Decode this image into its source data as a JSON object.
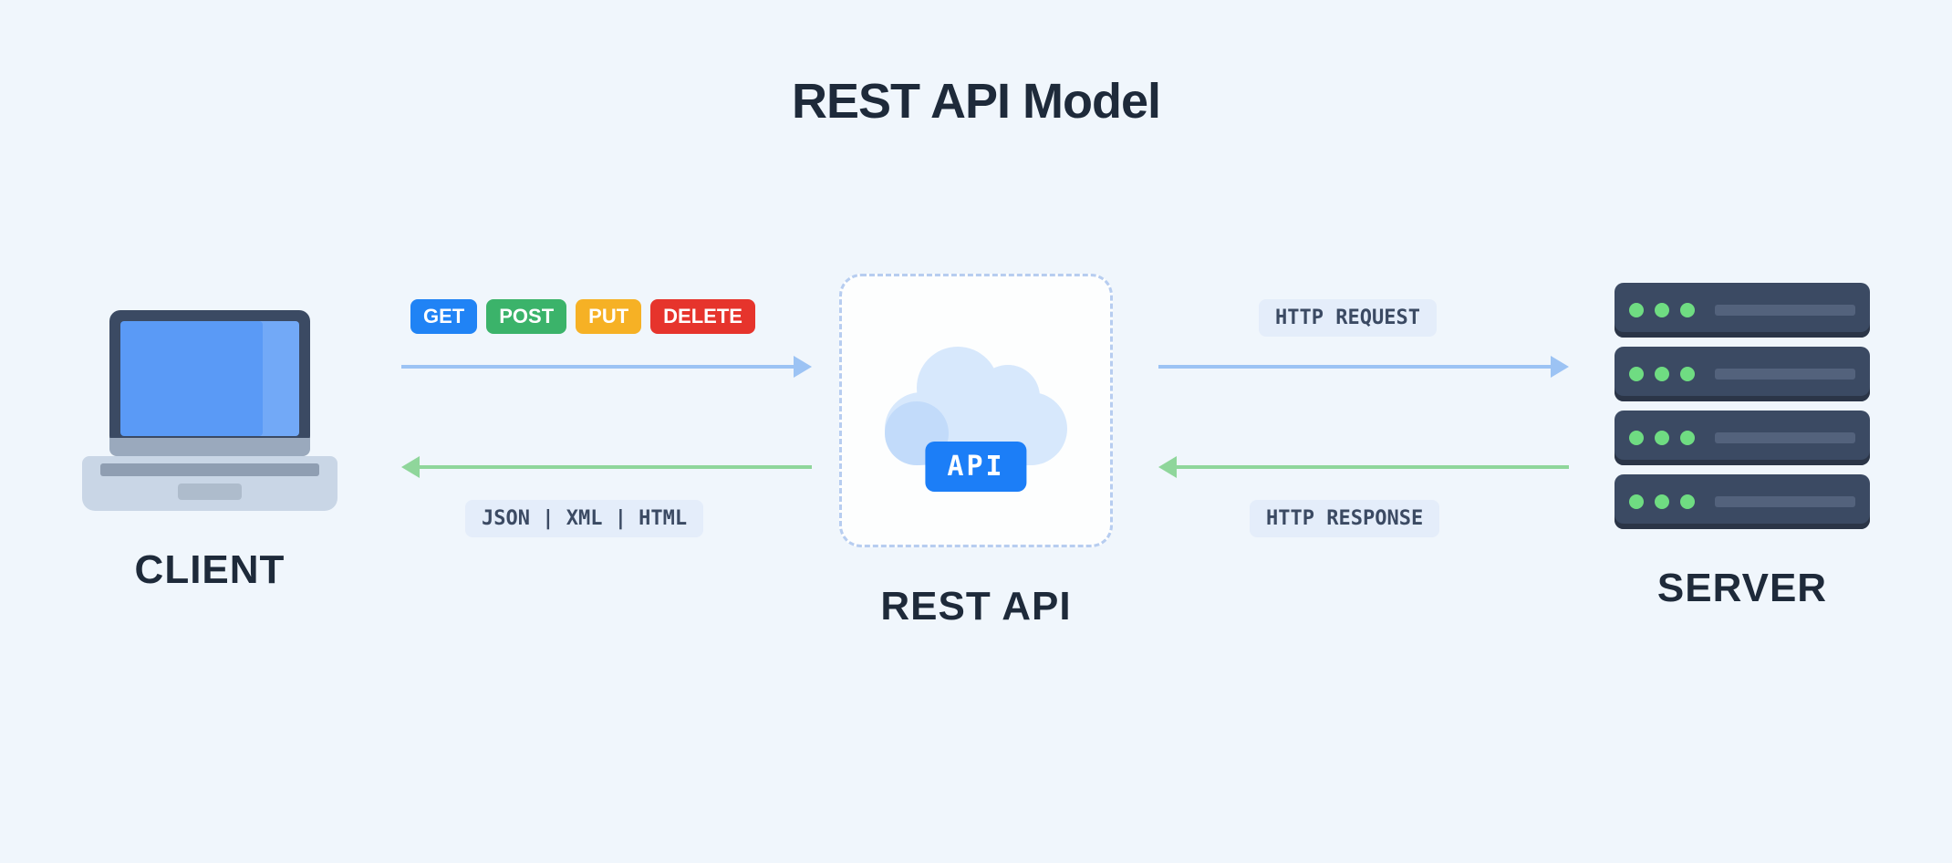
{
  "title": "REST API Model",
  "client": {
    "label": "CLIENT"
  },
  "api": {
    "label": "REST API",
    "badge": "API"
  },
  "server": {
    "label": "SERVER"
  },
  "methods": [
    {
      "name": "GET",
      "color": "#2083f5"
    },
    {
      "name": "POST",
      "color": "#3bb36a"
    },
    {
      "name": "PUT",
      "color": "#f6b125"
    },
    {
      "name": "DELETE",
      "color": "#e6342c"
    }
  ],
  "response_formats": "JSON | XML | HTML",
  "http_request_label": "HTTP REQUEST",
  "http_response_label": "HTTP RESPONSE",
  "colors": {
    "arrow_request": "#9cc3f4",
    "arrow_response": "#8fd69b",
    "chip_bg": "#e4edfa",
    "text_dark": "#1e2a3a"
  }
}
